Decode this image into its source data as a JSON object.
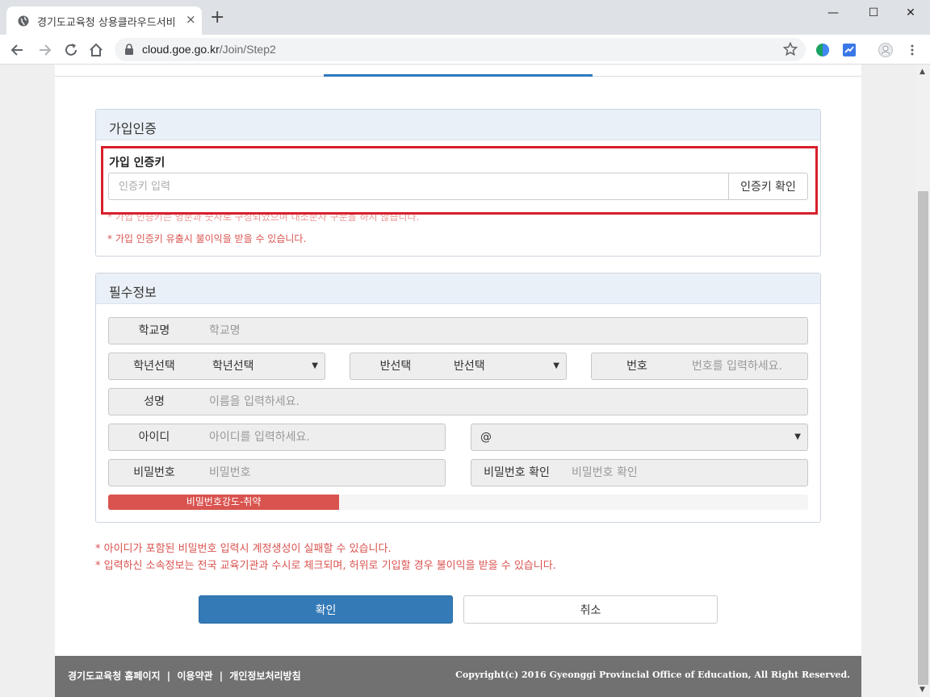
{
  "browser": {
    "tab_title": "경기도교육청 상용클라우드서비",
    "tab_close": "×",
    "new_tab": "+",
    "url_host": "cloud.goe.go.kr",
    "url_path": "/Join/Step2",
    "win_min": "—",
    "win_max": "☐",
    "win_close": "✕"
  },
  "auth_section": {
    "title": "가입인증",
    "key_label": "가입 인증키",
    "key_placeholder": "인증키 입력",
    "verify_button": "인증키 확인",
    "note1": "* 가입 인증키는 영문과 숫자로 구성되었으며 대소문자 구분을 하지 않습니다.",
    "note2": "* 가입 인증키 유출시 불이익을 받을 수 있습니다."
  },
  "required_section": {
    "title": "필수정보",
    "school_label": "학교명",
    "school_placeholder": "학교명",
    "grade_label": "학년선택",
    "grade_value": "학년선택",
    "class_label": "반선택",
    "class_value": "반선택",
    "number_label": "번호",
    "number_placeholder": "번호를 입력하세요.",
    "name_label": "성명",
    "name_placeholder": "이름을 입력하세요.",
    "id_label": "아이디",
    "id_placeholder": "아이디를 입력하세요.",
    "at_label": "@",
    "domain_value": "",
    "password_label": "비밀번호",
    "password_placeholder": "비밀번호",
    "password_confirm_label": "비밀번호 확인",
    "password_confirm_placeholder": "비밀번호 확인",
    "strength_text": "비밀번호강도-취약",
    "strength_percent": 33
  },
  "notes": {
    "note1": "* 아이디가 포함된 비밀번호 입력시 계정생성이 실패할 수 있습니다.",
    "note2": "* 입력하신 소속정보는 전국 교육기관과 수시로 체크되며, 허위로 기입할 경우 불이익을 받을 수 있습니다."
  },
  "buttons": {
    "confirm": "확인",
    "cancel": "취소"
  },
  "footer": {
    "link1": "경기도교육청 홈페이지",
    "sep": "|",
    "link2": "이용약관",
    "link3": "개인정보처리방침",
    "copyright": "Copyright(c) 2016 Gyeonggi Provincial Office of Education, All Right Reserved."
  },
  "colors": {
    "primary": "#337ab7",
    "danger": "#d9534f",
    "highlight": "#d7202c",
    "footer": "#717171"
  }
}
